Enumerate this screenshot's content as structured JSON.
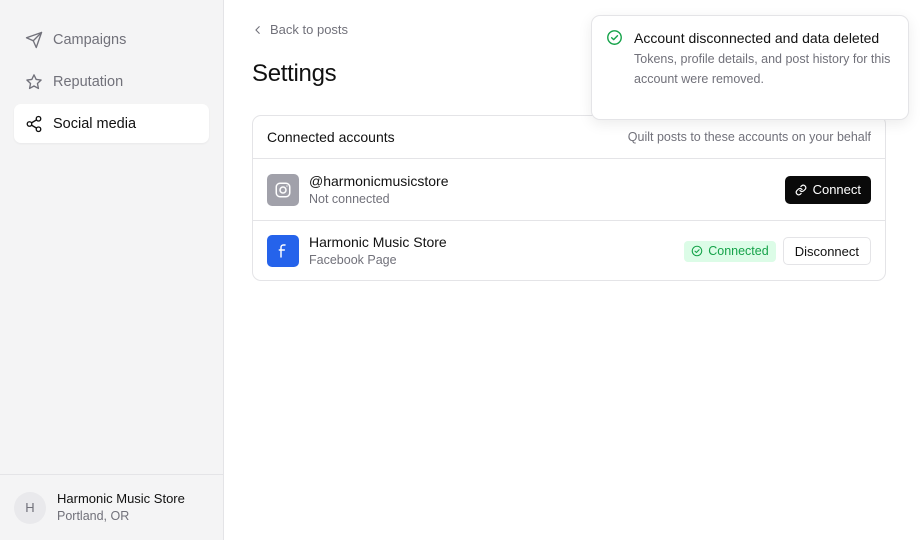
{
  "sidebar": {
    "items": [
      {
        "label": "Campaigns",
        "icon": "send-icon"
      },
      {
        "label": "Reputation",
        "icon": "star-icon"
      },
      {
        "label": "Social media",
        "icon": "share-icon",
        "active": true
      }
    ],
    "footer": {
      "avatar_initial": "H",
      "store_name": "Harmonic Music Store",
      "location": "Portland, OR"
    }
  },
  "main": {
    "back_label": "Back to posts",
    "title": "Settings",
    "card": {
      "title": "Connected accounts",
      "subtitle": "Quilt posts to these accounts on your behalf",
      "accounts": [
        {
          "name": "@harmonicmusicstore",
          "status": "Not connected",
          "platform_icon": "instagram-icon",
          "action_label": "Connect"
        },
        {
          "name": "Harmonic Music Store",
          "status": "Facebook Page",
          "platform_icon": "facebook-icon",
          "badge": "Connected",
          "action_label": "Disconnect"
        }
      ]
    }
  },
  "toast": {
    "title": "Account disconnected and data deleted",
    "body": "Tokens, profile details, and post history for this account were removed.",
    "icon": "check-circle-icon"
  },
  "colors": {
    "sidebar_bg": "#f4f4f5",
    "accent_dark": "#0a0a0a",
    "success": "#16a34a",
    "success_bg": "#dcfce7",
    "facebook": "#2563eb",
    "muted": "#71717a"
  }
}
